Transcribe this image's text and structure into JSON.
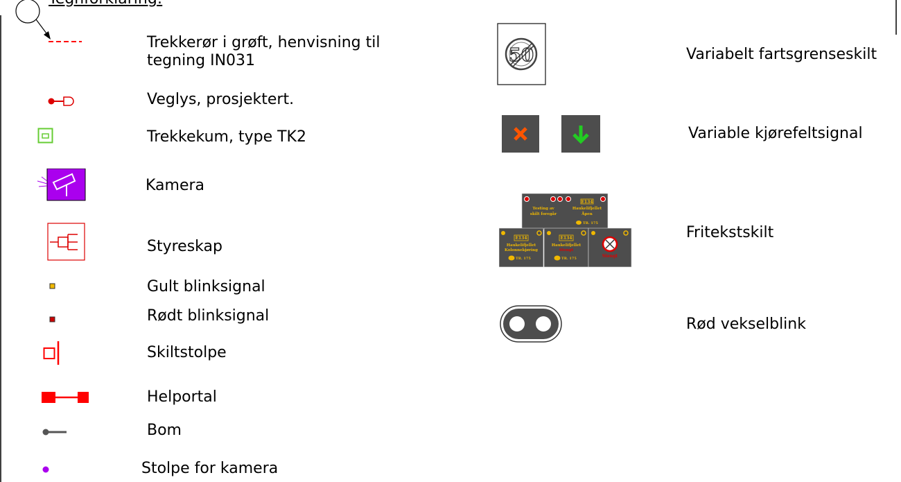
{
  "title": "Tegnforklaring:",
  "legend_left": [
    {
      "symbol": "dashed-red-line-icon",
      "label": "Trekkerør i grøft, henvisning til tegning IN031"
    },
    {
      "symbol": "road-light-icon",
      "label": "Veglys, prosjektert."
    },
    {
      "symbol": "pull-box-icon",
      "label": "Trekkekum, type TK2"
    },
    {
      "symbol": "camera-icon",
      "label": "Kamera"
    },
    {
      "symbol": "control-cabinet-icon",
      "label": "Styreskap"
    },
    {
      "symbol": "yellow-flash-icon",
      "label": "Gult blinksignal"
    },
    {
      "symbol": "red-flash-icon",
      "label": "Rødt blinksignal"
    },
    {
      "symbol": "sign-post-icon",
      "label": "Skiltstolpe"
    },
    {
      "symbol": "full-portal-icon",
      "label": "Helportal"
    },
    {
      "symbol": "barrier-icon",
      "label": "Bom"
    },
    {
      "symbol": "camera-post-icon",
      "label": "Stolpe for kamera"
    }
  ],
  "legend_right": [
    {
      "symbol": "variable-speed-sign-icon",
      "label": "Variabelt fartsgrenseskilt",
      "sign_value": "50"
    },
    {
      "symbol": "lane-signal-icon",
      "label": "Variable kjørefeltsignal"
    },
    {
      "symbol": "free-text-sign-icon",
      "label": "Fritekstskilt"
    },
    {
      "symbol": "alternating-red-flash-icon",
      "label": "Rød vekselblink"
    }
  ],
  "freetext_signs": {
    "top": {
      "road": "E134",
      "left_text": [
        "Testing av",
        "skilt foregår"
      ],
      "right_text": [
        "Haukelifjellet",
        "Åpen"
      ],
      "phone": "TR. 175"
    },
    "bottom_left": {
      "road": "E134",
      "text": [
        "Haukelifjellet",
        "Kolonnekjøring"
      ],
      "phone": "TR. 175"
    },
    "bottom_mid": {
      "road": "E134",
      "text": [
        "Haukelifjellet",
        "Stengt"
      ],
      "phone": "TR. 175"
    },
    "bottom_right": {
      "text": "Stengt"
    }
  },
  "colors": {
    "red": "#ff0000",
    "green": "#66cc33",
    "purple": "#aa00ee",
    "sign_gray": "#4d4d4d",
    "yellow": "#f0b800"
  }
}
